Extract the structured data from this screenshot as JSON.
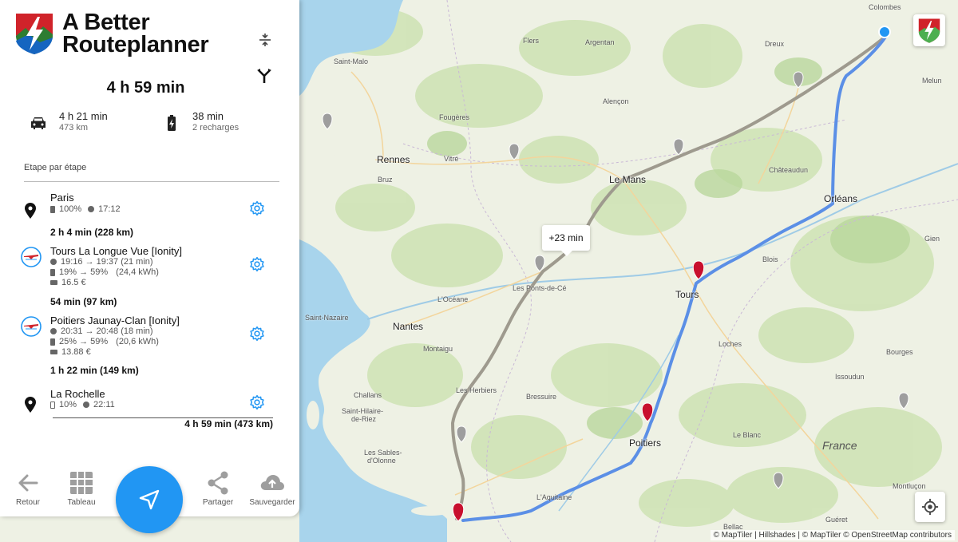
{
  "app": {
    "title_line1": "A Better",
    "title_line2": "Routeplanner"
  },
  "summary": {
    "total_time": "4 h 59 min",
    "drive_time": "4 h 21 min",
    "distance": "473 km",
    "charge_time": "38 min",
    "charge_count": "2 recharges"
  },
  "steps": {
    "title": "Etape par étape",
    "stops": [
      {
        "name": "Paris",
        "soc": "100%",
        "time": "17:12"
      },
      {
        "name": "Tours La Longue Vue [Ionity]",
        "times": "19:16 → 19:37 (21 min)",
        "charge": "19% → 59%",
        "energy": "(24,4 kWh)",
        "cost": "16.5 €"
      },
      {
        "name": "Poitiers Jaunay-Clan [Ionity]",
        "times": "20:31 → 20:48 (18 min)",
        "charge": "25% → 59%",
        "energy": "(20,6 kWh)",
        "cost": "13.88 €"
      },
      {
        "name": "La Rochelle",
        "soc": "10%",
        "time": "22:11"
      }
    ],
    "legs": [
      "2 h 4 min (228 km)",
      "54 min (97 km)",
      "1 h 22 min (149 km)"
    ],
    "final_total": "4 h 59 min (473 km)"
  },
  "nav": {
    "back": "Retour",
    "table": "Tableau",
    "share": "Partager",
    "save": "Sauvegarder"
  },
  "map": {
    "tooltip": "+23 min",
    "attribution": "© MapTiler | Hillshades | © MapTiler © OpenStreetMap contributors",
    "cities": {
      "rennes": "Rennes",
      "le_mans": "Le Mans",
      "orleans": "Orléans",
      "tours": "Tours",
      "nantes": "Nantes",
      "poitiers": "Poitiers",
      "france": "France"
    },
    "towns": {
      "colombes": "Colombes",
      "flers": "Flers",
      "argentan": "Argentan",
      "dreux": "Dreux",
      "saint_malo": "Saint-Malo",
      "alencon": "Alençon",
      "melun": "Melun",
      "fougeres": "Fougères",
      "vitre": "Vitré",
      "bruz": "Bruz",
      "chateaudun": "Châteaudun",
      "gien": "Gien",
      "blois": "Blois",
      "ponts_de_ce": "Les Ponts-de-Cé",
      "loceane": "L'Océane",
      "saint_nazaire": "Saint-Nazaire",
      "loches": "Loches",
      "bourges": "Bourges",
      "montaigu": "Montaigu",
      "issoudun": "Issoudun",
      "les_herbiers": "Les Herbiers",
      "challans": "Challans",
      "bressuire": "Bressuire",
      "saint_hilaire": "Saint-Hilaire-",
      "de_riez": "de-Riez",
      "le_blanc": "Le Blanc",
      "sables1": "Les Sables-",
      "sables2": "d'Olonne",
      "montlucon": "Montluçon",
      "laquitaine": "L'Aquitaine",
      "bellac": "Bellac",
      "gueret": "Guéret"
    }
  },
  "colors": {
    "accent": "#2196f3",
    "route_main": "#5b8fe6",
    "route_alt": "#9e9a8e",
    "charger_marker": "#c8102e",
    "logo_red": "#d0232a"
  }
}
